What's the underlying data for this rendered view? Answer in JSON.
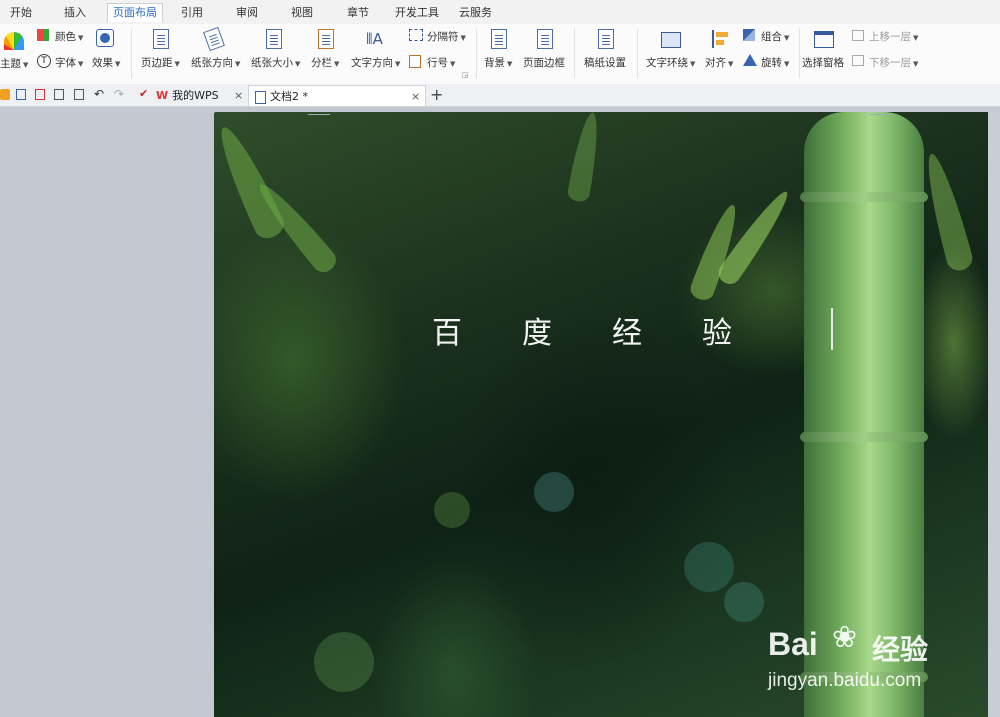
{
  "menu_tabs": [
    "开始",
    "插入",
    "页面布局",
    "引用",
    "审阅",
    "视图",
    "章节",
    "开发工具",
    "云服务"
  ],
  "active_tab": "页面布局",
  "ribbon": {
    "theme": "主题",
    "color": "颜色",
    "font": "字体",
    "effects": "效果",
    "margins": "页边距",
    "orientation": "纸张方向",
    "paper_size": "纸张大小",
    "columns": "分栏",
    "text_direction": "文字方向",
    "breaks": "分隔符",
    "line_numbers": "行号",
    "background": "背景",
    "page_borders": "页面边框",
    "manuscript_settings": "稿纸设置",
    "text_wrap": "文字环绕",
    "align": "对齐",
    "group": "组合",
    "rotate": "旋转",
    "selection_pane": "选择窗格",
    "bring_forward": "上移一层",
    "send_backward": "下移一层"
  },
  "doc_tabs": {
    "home": "我的WPS",
    "doc": "文档2 *",
    "new_tab": "+"
  },
  "document": {
    "title_text": "百度经验"
  },
  "watermark": {
    "brand": "Bai",
    "brand_cn": "经验",
    "url": "jingyan.baidu.com"
  },
  "colors": {
    "accent": "#2a6ec4",
    "ribbon_bg": "#fbfbfb",
    "workspace": "#c4c8d0"
  }
}
